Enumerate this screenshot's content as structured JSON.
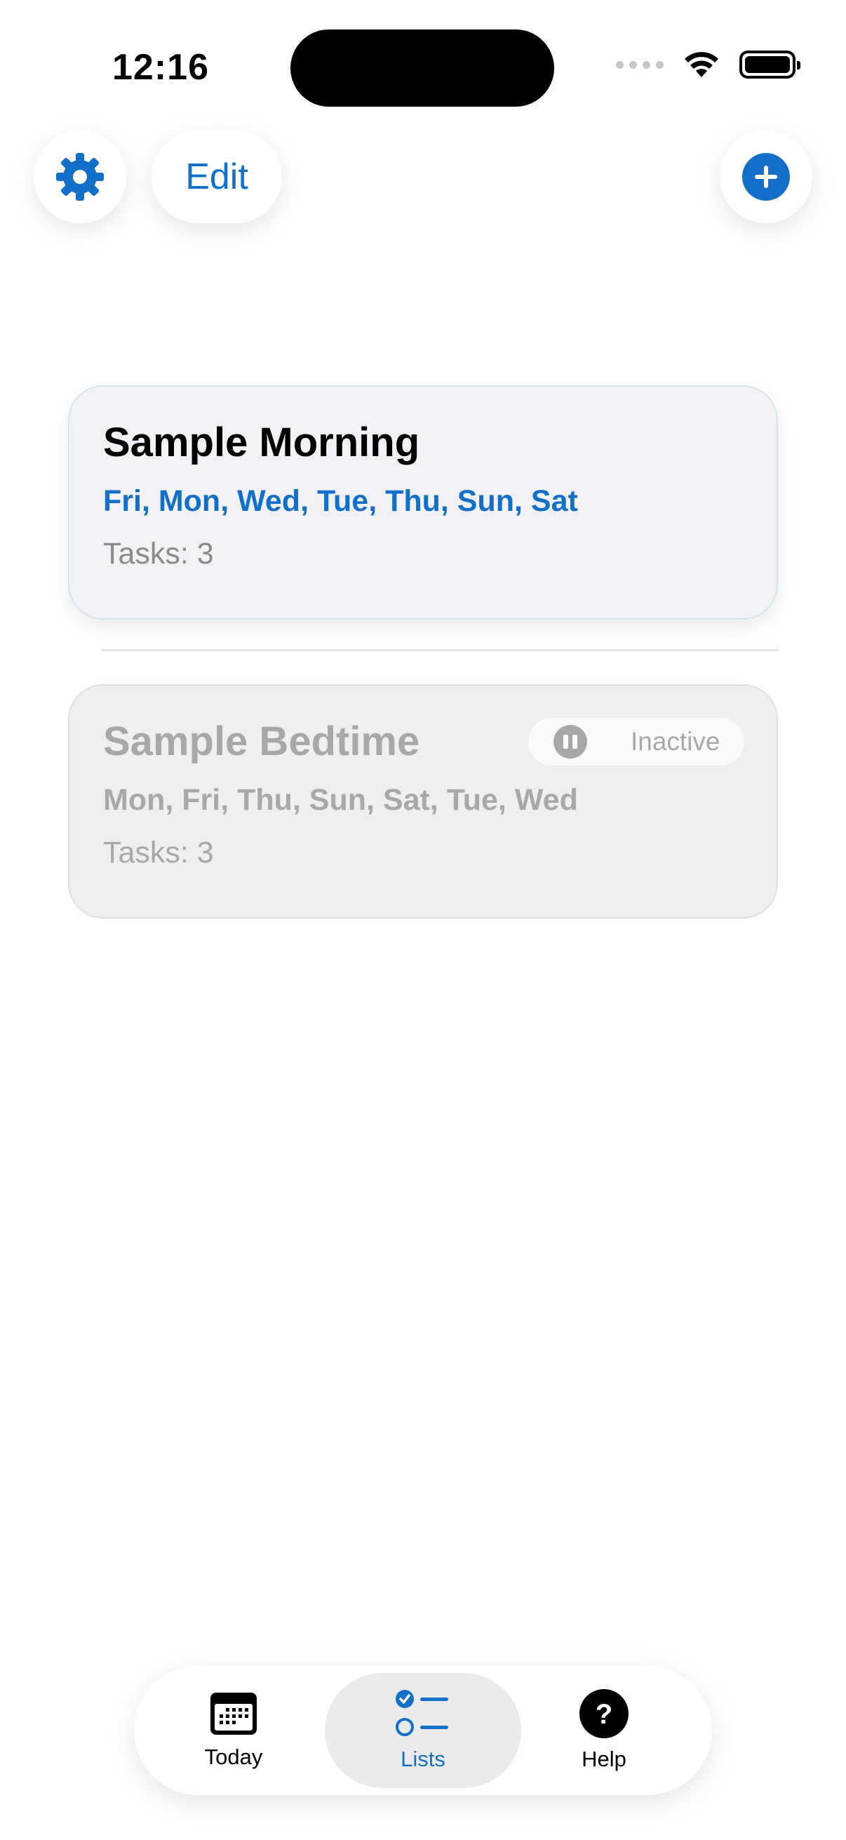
{
  "status_bar": {
    "time": "12:16"
  },
  "toolbar": {
    "settings_icon": "gear-icon",
    "edit_label": "Edit",
    "add_icon": "plus-circle-icon"
  },
  "lists": [
    {
      "title": "Sample Morning",
      "days": "Fri, Mon, Wed, Tue, Thu, Sun, Sat",
      "tasks": "Tasks: 3",
      "active": true
    },
    {
      "title": "Sample Bedtime",
      "days": "Mon, Fri, Thu, Sun, Sat, Tue, Wed",
      "tasks": "Tasks: 3",
      "active": false,
      "badge": "Inactive"
    }
  ],
  "tabbar": {
    "tabs": [
      {
        "label": "Today",
        "icon": "calendar-icon"
      },
      {
        "label": "Lists",
        "icon": "checklist-icon",
        "selected": true
      },
      {
        "label": "Help",
        "icon": "question-circle-icon"
      }
    ]
  },
  "colors": {
    "accent": "#1270c9",
    "inactive_text": "#a8a8aa",
    "card_bg": "#f1f1f6"
  }
}
